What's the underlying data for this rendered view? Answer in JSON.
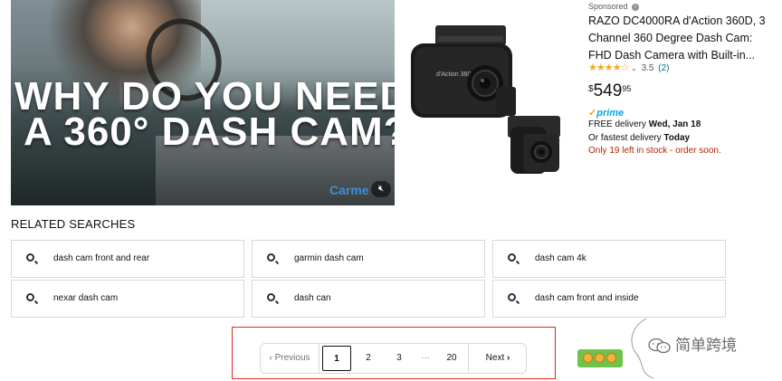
{
  "ad": {
    "video_headline_line1": "WHY DO YOU NEED",
    "video_headline_line2": "A 360° DASH CAM?",
    "video_brand": "Carme",
    "mute_icon": "speaker-muted-icon",
    "sponsored_label": "Sponsored",
    "product_title": "RAZO DC4000RA d'Action 360D, 3 Channel 360 Degree Dash Cam: FHD Dash Camera with Built-in...",
    "rating_stars": "★★★★☆",
    "rating_value": "3.5",
    "review_count": "(2)",
    "price_symbol": "$",
    "price_whole": "549",
    "price_fraction": "95",
    "prime_label": "prime",
    "delivery_prefix": "FREE delivery ",
    "delivery_date": "Wed, Jan 18",
    "fastest_prefix": "Or fastest delivery ",
    "fastest_date": "Today",
    "stock_note": "Only 19 left in stock - order soon."
  },
  "related": {
    "title": "RELATED SEARCHES",
    "items": [
      "dash cam front and rear",
      "garmin dash cam",
      "dash cam 4k",
      "nexar dash cam",
      "dash can",
      "dash cam front and inside"
    ]
  },
  "pagination": {
    "previous": "Previous",
    "current": "1",
    "page2": "2",
    "page3": "3",
    "ellipsis": "···",
    "last": "20",
    "next": "Next"
  },
  "overlay": {
    "watermark_text": "简单跨境"
  },
  "colors": {
    "accent_link": "#007185",
    "stock_red": "#b12704",
    "prime_blue": "#00a8e1",
    "star_orange": "#f5a623",
    "highlight_box": "#e1251b"
  }
}
